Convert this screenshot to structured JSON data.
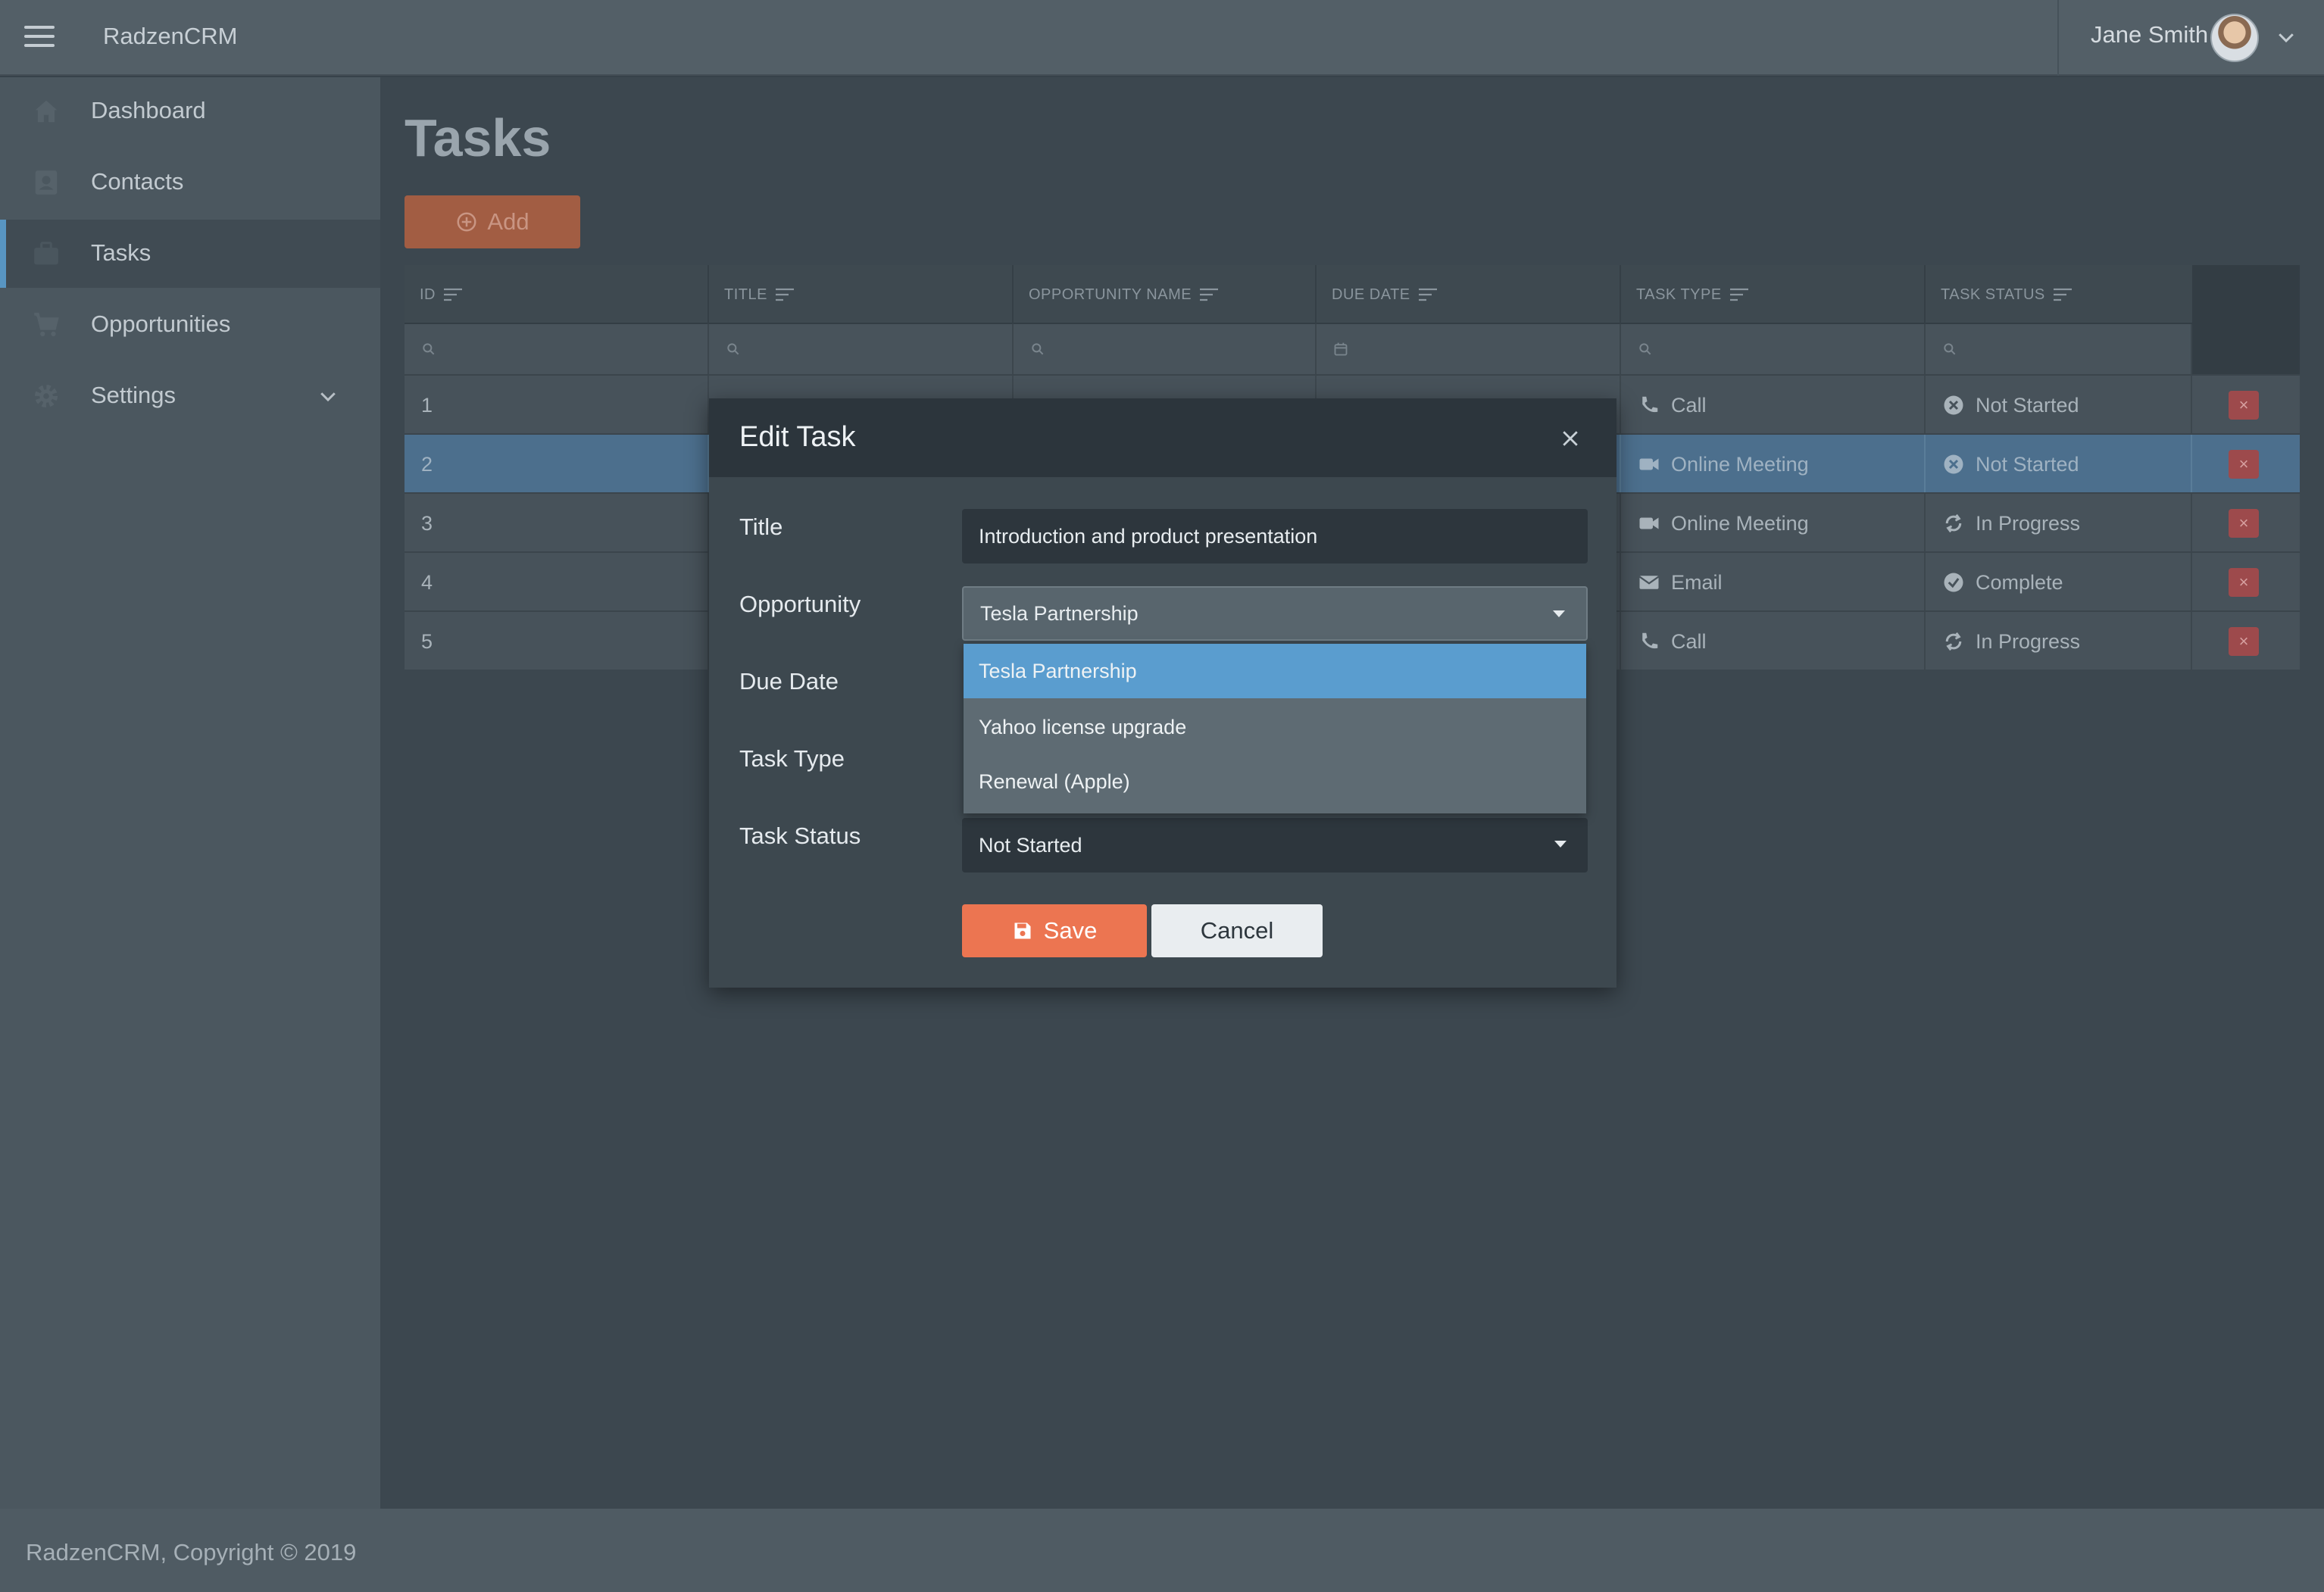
{
  "app": {
    "brand": "RadzenCRM",
    "user_name": "Jane Smith"
  },
  "sidebar": {
    "items": [
      {
        "label": "Dashboard",
        "icon": "home-icon"
      },
      {
        "label": "Contacts",
        "icon": "contact-card-icon"
      },
      {
        "label": "Tasks",
        "icon": "briefcase-icon",
        "active": true
      },
      {
        "label": "Opportunities",
        "icon": "cart-icon"
      },
      {
        "label": "Settings",
        "icon": "gear-icon",
        "expandable": true
      }
    ]
  },
  "page": {
    "title": "Tasks",
    "add_label": "Add"
  },
  "grid": {
    "columns": [
      "ID",
      "TITLE",
      "OPPORTUNITY NAME",
      "DUE DATE",
      "TASK TYPE",
      "TASK STATUS"
    ],
    "rows": [
      {
        "id": "1",
        "task_type": "Call",
        "type_icon": "phone-icon",
        "task_status": "Not Started",
        "status_icon": "x-circle-icon"
      },
      {
        "id": "2",
        "task_type": "Online Meeting",
        "type_icon": "video-camera-icon",
        "task_status": "Not Started",
        "status_icon": "x-circle-icon",
        "selected": true
      },
      {
        "id": "3",
        "task_type": "Online Meeting",
        "type_icon": "video-camera-icon",
        "task_status": "In Progress",
        "status_icon": "refresh-icon"
      },
      {
        "id": "4",
        "task_type": "Email",
        "type_icon": "envelope-icon",
        "task_status": "Complete",
        "status_icon": "check-circle-icon"
      },
      {
        "id": "5",
        "task_type": "Call",
        "type_icon": "phone-icon",
        "task_status": "In Progress",
        "status_icon": "refresh-icon"
      }
    ],
    "delete_glyph": "×"
  },
  "dialog": {
    "title": "Edit Task",
    "labels": {
      "title": "Title",
      "opportunity": "Opportunity",
      "due_date": "Due Date",
      "task_type": "Task Type",
      "task_status": "Task Status"
    },
    "values": {
      "title": "Introduction and product presentation",
      "opportunity": "Tesla Partnership",
      "task_status": "Not Started"
    },
    "opportunity_options": [
      "Tesla Partnership",
      "Yahoo license upgrade",
      "Renewal (Apple)"
    ],
    "save_label": "Save",
    "cancel_label": "Cancel"
  },
  "footer": {
    "text": "RadzenCRM, Copyright © 2019"
  },
  "colors": {
    "accent": "#ec7551",
    "selection": "#5a9dcf",
    "danger": "#9d4a4c"
  }
}
